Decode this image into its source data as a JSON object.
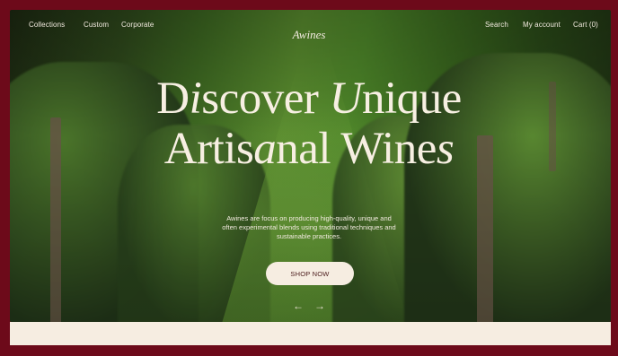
{
  "nav": {
    "left": [
      "Collections",
      "Custom",
      "Corporate"
    ],
    "right": [
      "Search",
      "My account",
      "Cart (0)"
    ]
  },
  "brand": {
    "logo": "Awines"
  },
  "hero": {
    "line1_parts": [
      "D",
      "i",
      "scover ",
      "U",
      "nique"
    ],
    "line2_parts": [
      "Artis",
      "a",
      "nal Wine",
      "s"
    ],
    "description": "Awines are focus on producing high-quality, unique and often experimental blends using traditional techniques and sustainable practices.",
    "cta": "SHOP NOW",
    "prev_arrow": "←",
    "next_arrow": "→"
  },
  "colors": {
    "frame": "#6d0a1a",
    "cream": "#f6ede1",
    "text_light": "#f2eadf"
  }
}
